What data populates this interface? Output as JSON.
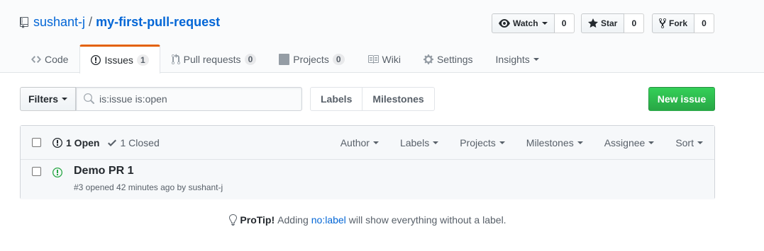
{
  "repo": {
    "owner": "sushant-j",
    "separator": "/",
    "name": "my-first-pull-request"
  },
  "actions": {
    "watch": {
      "label": "Watch",
      "count": "0"
    },
    "star": {
      "label": "Star",
      "count": "0"
    },
    "fork": {
      "label": "Fork",
      "count": "0"
    }
  },
  "nav": {
    "code": "Code",
    "issues": {
      "label": "Issues",
      "count": "1"
    },
    "pulls": {
      "label": "Pull requests",
      "count": "0"
    },
    "projects": {
      "label": "Projects",
      "count": "0"
    },
    "wiki": "Wiki",
    "settings": "Settings",
    "insights": "Insights"
  },
  "subnav": {
    "filters": "Filters",
    "search_value": "is:issue is:open",
    "labels": "Labels",
    "milestones": "Milestones",
    "new_issue": "New issue"
  },
  "issues_header": {
    "open": "1 Open",
    "closed": "1 Closed",
    "menus": [
      "Author",
      "Labels",
      "Projects",
      "Milestones",
      "Assignee",
      "Sort"
    ]
  },
  "issues": [
    {
      "title": "Demo PR 1",
      "meta": "#3 opened 42 minutes ago by sushant-j"
    }
  ],
  "protip": {
    "strong": "ProTip!",
    "before": "Adding",
    "link": "no:label",
    "after": "will show everything without a label."
  },
  "colors": {
    "link": "#0366d6",
    "accent_tab": "#e36209",
    "green": "#28a745",
    "muted": "#586069"
  },
  "icons": [
    "repo-icon",
    "eye-icon",
    "star-icon",
    "fork-icon",
    "code-icon",
    "issue-opened-icon",
    "git-pull-request-icon",
    "project-icon",
    "book-icon",
    "gear-icon",
    "search-icon",
    "check-icon",
    "light-bulb-icon"
  ]
}
